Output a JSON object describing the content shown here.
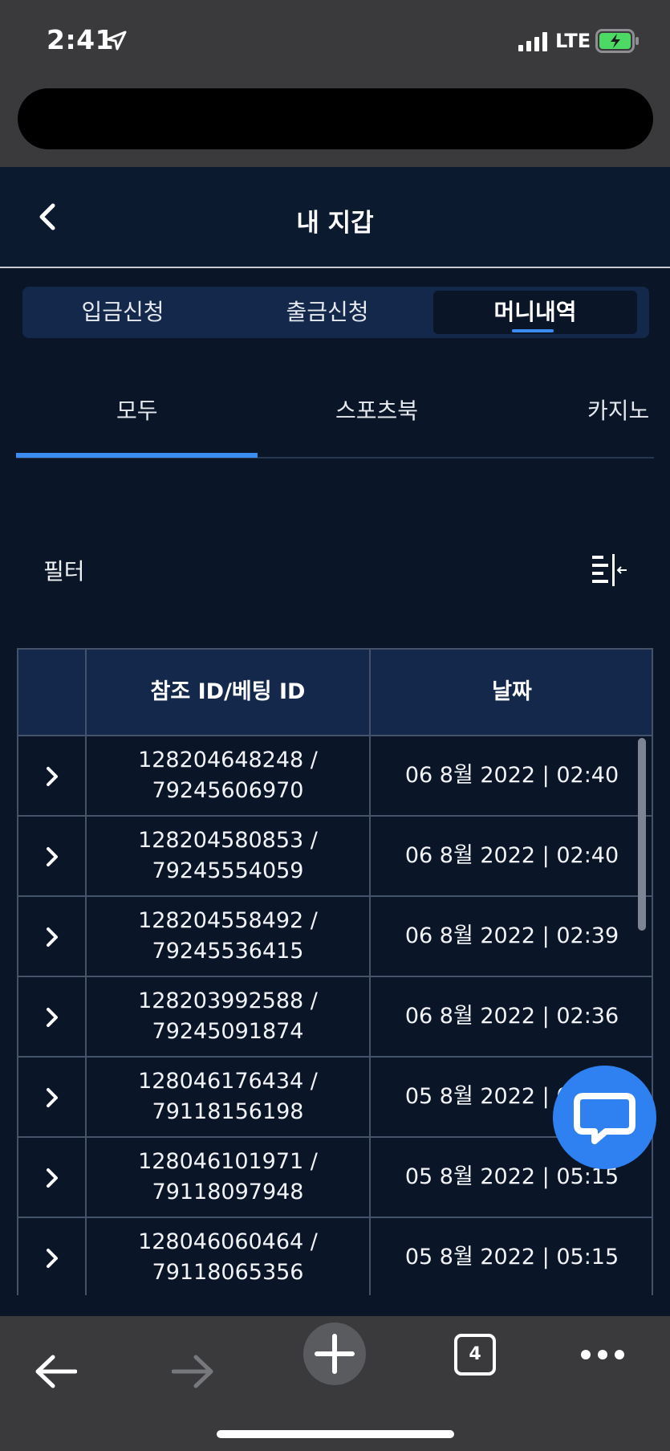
{
  "status_bar": {
    "time": "2:41",
    "network": "LTE"
  },
  "header": {
    "title": "내 지갑"
  },
  "seg_tabs": [
    "입금신청",
    "출금신청",
    "머니내역"
  ],
  "sub_tabs": [
    "모두",
    "스포츠북",
    "카지노"
  ],
  "filter": {
    "label": "필터"
  },
  "table": {
    "headers": [
      "",
      "참조 ID/베팅 ID",
      "날짜"
    ],
    "rows": [
      {
        "ref_id": "128204648248 /",
        "bet_id": "79245606970",
        "date": "06 8월 2022 | 02:40"
      },
      {
        "ref_id": "128204580853 /",
        "bet_id": "79245554059",
        "date": "06 8월 2022 | 02:40"
      },
      {
        "ref_id": "128204558492 /",
        "bet_id": "79245536415",
        "date": "06 8월 2022 | 02:39"
      },
      {
        "ref_id": "128203992588 /",
        "bet_id": "79245091874",
        "date": "06 8월 2022 | 02:36"
      },
      {
        "ref_id": "128046176434 /",
        "bet_id": "79118156198",
        "date": "05 8월 2022 | 05:15"
      },
      {
        "ref_id": "128046101971 /",
        "bet_id": "79118097948",
        "date": "05 8월 2022 | 05:15"
      },
      {
        "ref_id": "128046060464 /",
        "bet_id": "79118065356",
        "date": "05 8월 2022 | 05:15"
      }
    ]
  },
  "toolbar": {
    "tab_count": "4"
  },
  "colors": {
    "background": "#0a1628",
    "accent": "#3b8cf0",
    "chat_button": "#2f80f0",
    "battery": "#4cd964"
  },
  "icons": {
    "back": "chevron-left-icon",
    "filter": "filter-collapse-icon",
    "row_expand": "chevron-right-icon",
    "chat": "chat-bubble-icon"
  }
}
